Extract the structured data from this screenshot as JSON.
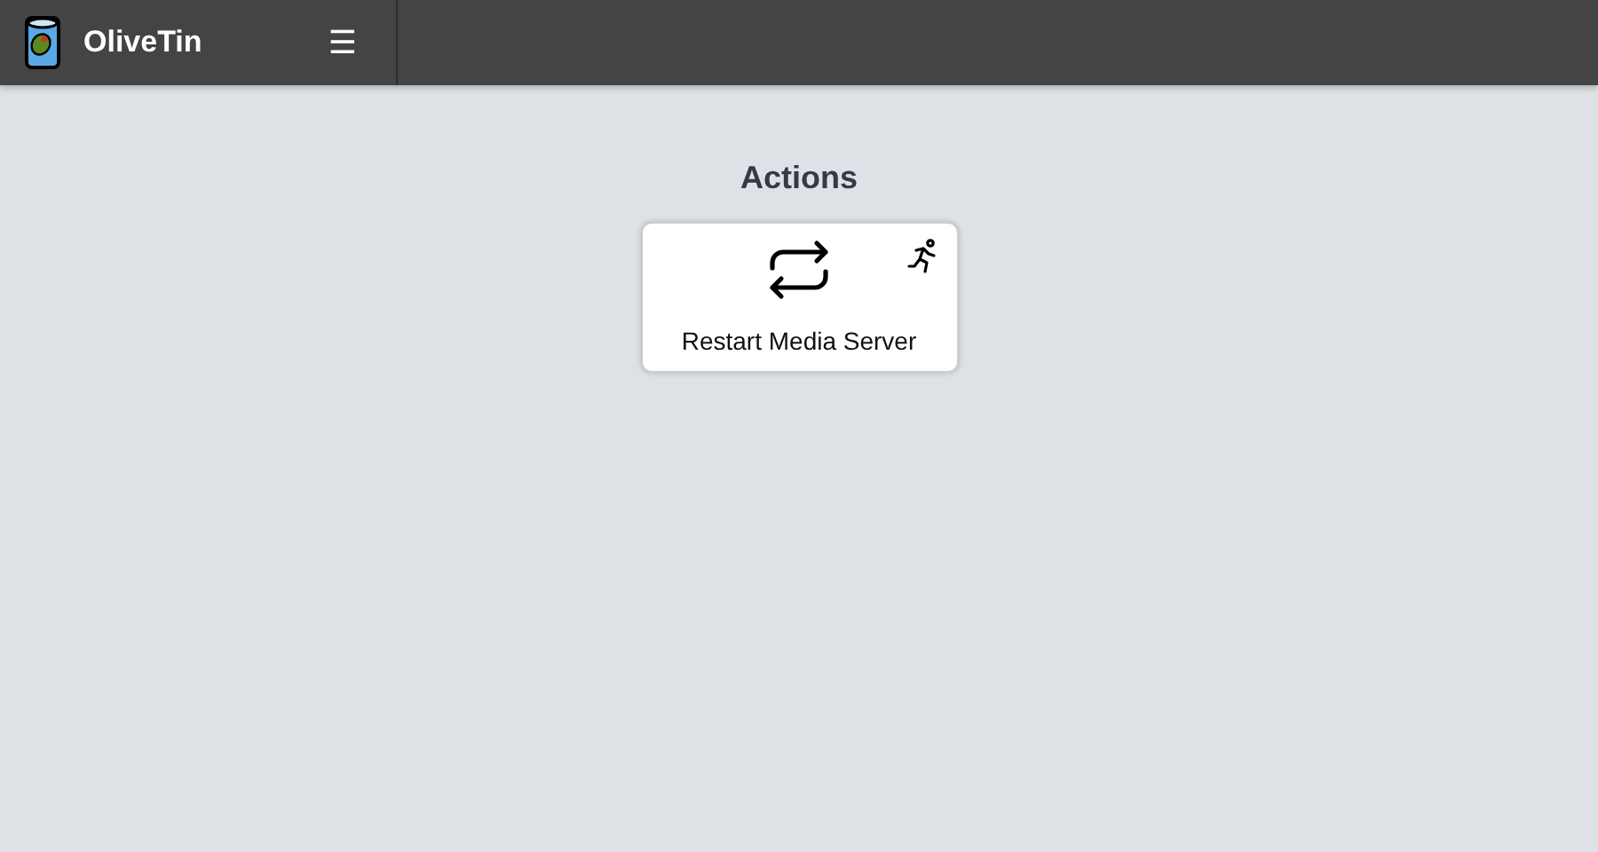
{
  "header": {
    "title": "OliveTin",
    "menu_glyph": "☰"
  },
  "section": {
    "title": "Actions"
  },
  "actions": [
    {
      "label": "Restart Media Server"
    }
  ]
}
